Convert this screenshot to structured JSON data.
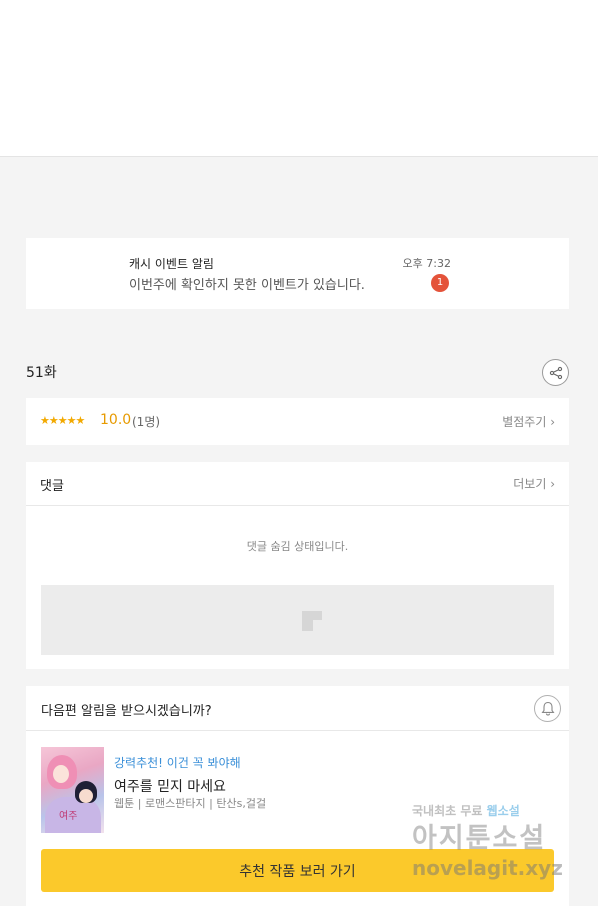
{
  "notification": {
    "title": "캐시 이벤트 알림",
    "message": "이번주에 확인하지 못한 이벤트가 있습니다.",
    "time": "오후 7:32",
    "badge": "1"
  },
  "episode": {
    "title": "51화",
    "share_icon": "share-icon"
  },
  "rating": {
    "stars": "★★★★★",
    "score": "10.0",
    "count": "(1명)",
    "rate_link": "별점주기 ›"
  },
  "comments": {
    "title": "댓글",
    "more_link": "더보기 ›",
    "hidden_message": "댓글 숨김 상태입니다."
  },
  "next_episode": {
    "question": "다음편 알림을 받으시겠습니까?",
    "bell_icon": "bell-icon",
    "promo_label": "강력추천! 이건 꼭 봐야해",
    "book_title": "여주를 믿지 마세요",
    "book_tags": "웹툰 | 로맨스판타지 | 탄산s,걸걸",
    "thumbnail_text": "여주",
    "cta_label": "추천 작품 보러 가기"
  },
  "watermark": {
    "line1_a": "국내최초 무료",
    "line1_b": "웹소설",
    "line2": "아지툰소설",
    "line3": "novelagit.xyz"
  },
  "colors": {
    "background": "#f4f4f4",
    "badge": "#e4533a",
    "star": "#f2a900",
    "promo": "#3a8fd8",
    "cta": "#fbc92b"
  }
}
